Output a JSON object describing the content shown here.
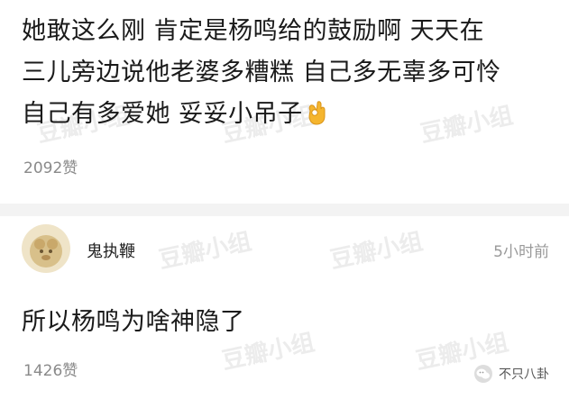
{
  "comment1": {
    "text": "她敢这么刚 肯定是杨鸣给的鼓励啊 天天在\n三儿旁边说他老婆多糟糕 自己多无辜多可怜\n自己有多爱她 妥妥小吊子",
    "emoji": "ok-hand-icon",
    "likes": "2092赞"
  },
  "reply": {
    "username": "鬼执鞭",
    "timestamp": "5小时前",
    "text": "所以杨鸣为啥神隐了",
    "likes": "1426赞"
  },
  "watermark": {
    "text": "豆瓣小组"
  },
  "source_badge": {
    "text": "不只八卦",
    "icon": "wechat-icon"
  },
  "colors": {
    "text_primary": "#1a1a1a",
    "text_secondary": "#8a8a8a",
    "divider": "#f3f3f3",
    "avatar_tone": "#d8c08a",
    "emoji_yellow": "#f5b52e"
  }
}
